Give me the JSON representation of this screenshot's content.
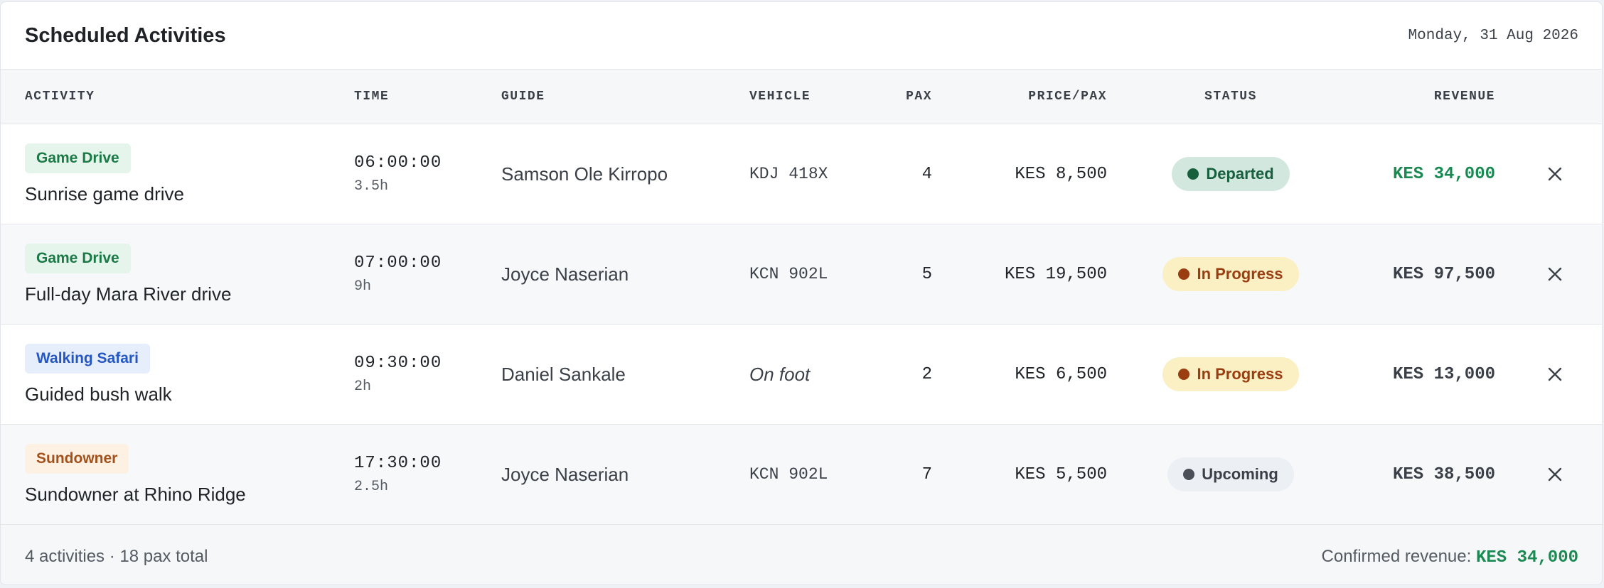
{
  "header": {
    "title": "Scheduled Activities",
    "date": "Monday, 31 Aug 2026"
  },
  "table": {
    "columns": {
      "activity": "Activity",
      "time": "Time",
      "guide": "Guide",
      "vehicle": "Vehicle",
      "pax": "Pax",
      "price": "Price/Pax",
      "status": "Status",
      "revenue": "Revenue"
    },
    "rows": [
      {
        "tag": "Game Drive",
        "name": "Sunrise game drive",
        "time": "06:00:00",
        "duration": "3.5h",
        "guide": "Samson Ole Kirropo",
        "vehicle": "KDJ 418X",
        "pax": "4",
        "price": "KES 8,500",
        "status": "Departed",
        "revenue": "KES 34,000"
      },
      {
        "tag": "Game Drive",
        "name": "Full-day Mara River drive",
        "time": "07:00:00",
        "duration": "9h",
        "guide": "Joyce Naserian",
        "vehicle": "KCN 902L",
        "pax": "5",
        "price": "KES 19,500",
        "status": "In Progress",
        "revenue": "KES 97,500"
      },
      {
        "tag": "Walking Safari",
        "name": "Guided bush walk",
        "time": "09:30:00",
        "duration": "2h",
        "guide": "Daniel Sankale",
        "vehicle": "On foot",
        "pax": "2",
        "price": "KES 6,500",
        "status": "In Progress",
        "revenue": "KES 13,000"
      },
      {
        "tag": "Sundowner",
        "name": "Sundowner at Rhino Ridge",
        "time": "17:30:00",
        "duration": "2.5h",
        "guide": "Joyce Naserian",
        "vehicle": "KCN 902L",
        "pax": "7",
        "price": "KES 5,500",
        "status": "Upcoming",
        "revenue": "KES 38,500"
      }
    ]
  },
  "footer": {
    "summary": "4 activities · 18 pax total",
    "confirmed_label": "Confirmed revenue: ",
    "confirmed_amount": "KES 34,000"
  },
  "icons": {
    "remove": "close-icon",
    "status_dot": "dot-icon"
  },
  "colors": {
    "tag_game_drive": "#1a7a45",
    "tag_walking_safari": "#2457c5",
    "tag_sundowner": "#a3501a",
    "status_departed": "#17603e",
    "status_in_progress": "#9a3e12",
    "status_upcoming": "#4b5058",
    "confirmed_revenue": "#1a8a52"
  }
}
